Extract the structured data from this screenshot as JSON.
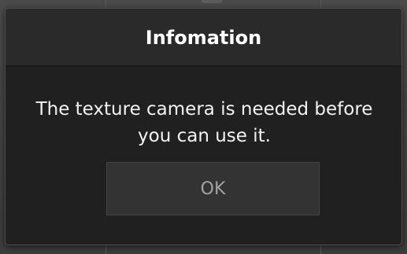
{
  "dialog": {
    "title": "Infomation",
    "message": "The texture camera is needed before you can use it.",
    "ok_label": "OK"
  },
  "colors": {
    "dialog_background": "#202020",
    "header_background": "#2a2a2a",
    "button_background": "#333333",
    "button_text": "#a3a3a3",
    "title_text": "#ffffff"
  }
}
